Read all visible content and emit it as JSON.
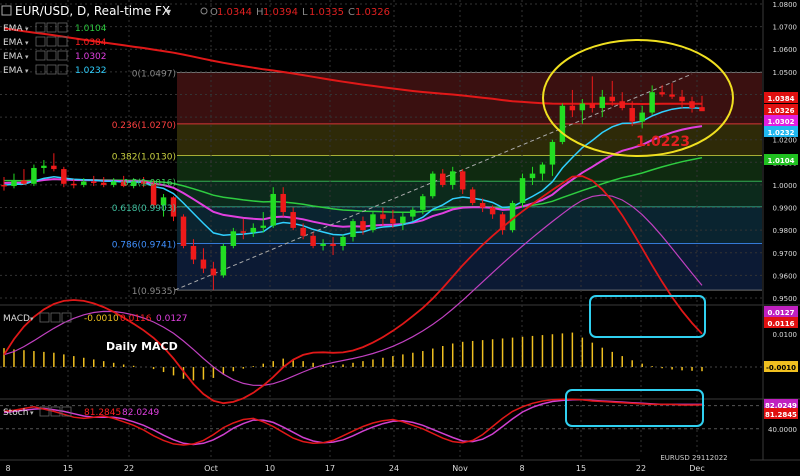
{
  "header": {
    "symbol_label": "EUR/USD, D, Real-time FX",
    "dropdown_arrow": "▾",
    "ohlc": [
      {
        "key": "O",
        "value": "1.0344"
      },
      {
        "key": "H",
        "value": "1.0394"
      },
      {
        "key": "L",
        "value": "1.0335"
      },
      {
        "key": "C",
        "value": "1.0326"
      }
    ]
  },
  "ema_legend": [
    {
      "label": "EMA",
      "value": "1.0104",
      "color": "#2ecc40"
    },
    {
      "label": "EMA",
      "value": "1.0384",
      "color": "#ff2020"
    },
    {
      "label": "EMA",
      "value": "1.0302",
      "color": "#e040e0"
    },
    {
      "label": "EMA",
      "value": "1.0232",
      "color": "#30d0ff"
    }
  ],
  "fib_levels": [
    {
      "text": "0(1.0497)",
      "value": 1.0497,
      "color": "#888888"
    },
    {
      "text": "0.236(1.0270)",
      "value": 1.027,
      "color": "#ff4040"
    },
    {
      "text": "0.382(1.0130)",
      "value": 1.013,
      "color": "#c8d040"
    },
    {
      "text": "0.5(1.0016)",
      "value": 1.0016,
      "color": "#40d060"
    },
    {
      "text": "0.618(0.9903)",
      "value": 0.9903,
      "color": "#40c0a0"
    },
    {
      "text": "0.786(0.9741)",
      "value": 0.9741,
      "color": "#4090ff"
    },
    {
      "text": "1(0.9535)",
      "value": 0.9535,
      "color": "#888888"
    }
  ],
  "annotation_value": "1.0223",
  "price_axis": [
    "1.0800",
    "1.0700",
    "1.0600",
    "1.0500",
    "1.0400",
    "1.0300",
    "1.0200",
    "1.0100",
    "1.0000",
    "0.9900",
    "0.9800",
    "0.9700",
    "0.9600",
    "0.9500"
  ],
  "price_tags": [
    {
      "text": "1.0384",
      "value": 1.0384,
      "color": "#e01010"
    },
    {
      "text": "1.0326",
      "value": 1.0326,
      "color": "#e01010"
    },
    {
      "text": "1.0302",
      "value": 1.0302,
      "color": "#e020e0"
    },
    {
      "text": "1.0232",
      "value": 1.0232,
      "color": "#20b8f0"
    },
    {
      "text": "1.0104",
      "value": 1.0104,
      "color": "#20c020"
    }
  ],
  "macd": {
    "label": "MACD",
    "values": [
      {
        "text": "-0.0010",
        "color": "#f0c020"
      },
      {
        "text": "0.0116",
        "color": "#ff2020"
      },
      {
        "text": "0.0127",
        "color": "#e040e0"
      }
    ],
    "title": "Daily MACD",
    "axis": [
      "0.0100",
      "0.0000"
    ],
    "tags": [
      {
        "text": "0.0127",
        "color": "#c020c0"
      },
      {
        "text": "0.0116",
        "color": "#e01010"
      },
      {
        "text": "-0.0010",
        "color": "#f0c020"
      }
    ]
  },
  "stoch": {
    "label": "Stoch",
    "values": [
      {
        "text": "81.2845",
        "color": "#ff2020"
      },
      {
        "text": "82.0249",
        "color": "#e040e0"
      }
    ],
    "axis": [
      "80.0000",
      "40.0000"
    ],
    "tags": [
      {
        "text": "82.0249",
        "color": "#c020c0"
      },
      {
        "text": "81.2845",
        "color": "#e01010"
      }
    ]
  },
  "x_axis": [
    "8",
    "15",
    "22",
    "Oct",
    "10",
    "17",
    "24",
    "Nov",
    "8",
    "15",
    "22",
    "Dec"
  ],
  "watermark": "EURUSD 29112022",
  "chart_data": {
    "type": "candlestick",
    "x_unit": "trading day",
    "y_range": [
      0.95,
      1.08
    ],
    "candles": [
      [
        1.0,
        1.0035,
        0.9975,
        0.9995
      ],
      [
        0.9995,
        1.005,
        0.9985,
        1.002
      ],
      [
        1.002,
        1.007,
        1.0,
        1.0005
      ],
      [
        1.0005,
        1.009,
        0.9995,
        1.0075
      ],
      [
        1.0075,
        1.011,
        1.005,
        1.0085
      ],
      [
        1.0085,
        1.014,
        1.006,
        1.007
      ],
      [
        1.007,
        1.008,
        0.999,
        1.0005
      ],
      [
        1.0005,
        1.0025,
        0.9985,
        1.0
      ],
      [
        1.0,
        1.003,
        0.999,
        1.0015
      ],
      [
        1.0015,
        1.004,
        0.9995,
        1.001
      ],
      [
        1.001,
        1.0035,
        0.999,
        1.0
      ],
      [
        1.0,
        1.003,
        0.999,
        1.0015
      ],
      [
        1.0015,
        1.004,
        0.999,
        0.9995
      ],
      [
        0.9995,
        1.003,
        0.9985,
        1.0015
      ],
      [
        1.0015,
        1.0035,
        0.999,
        1.0005
      ],
      [
        1.0005,
        1.002,
        0.99,
        0.991
      ],
      [
        0.991,
        0.996,
        0.986,
        0.9945
      ],
      [
        0.9945,
        0.995,
        0.984,
        0.986
      ],
      [
        0.986,
        0.987,
        0.972,
        0.973
      ],
      [
        0.973,
        0.976,
        0.965,
        0.967
      ],
      [
        0.967,
        0.972,
        0.961,
        0.963
      ],
      [
        0.963,
        0.966,
        0.9535,
        0.96
      ],
      [
        0.96,
        0.974,
        0.959,
        0.973
      ],
      [
        0.973,
        0.981,
        0.972,
        0.9795
      ],
      [
        0.9795,
        0.985,
        0.976,
        0.979
      ],
      [
        0.979,
        0.983,
        0.977,
        0.981
      ],
      [
        0.981,
        0.988,
        0.979,
        0.982
      ],
      [
        0.982,
        0.999,
        0.981,
        0.996
      ],
      [
        0.996,
        0.999,
        0.986,
        0.988
      ],
      [
        0.988,
        0.99,
        0.98,
        0.981
      ],
      [
        0.981,
        0.983,
        0.976,
        0.9775
      ],
      [
        0.9775,
        0.979,
        0.972,
        0.973
      ],
      [
        0.973,
        0.976,
        0.971,
        0.974
      ],
      [
        0.974,
        0.977,
        0.969,
        0.973
      ],
      [
        0.973,
        0.978,
        0.971,
        0.977
      ],
      [
        0.977,
        0.985,
        0.975,
        0.984
      ],
      [
        0.984,
        0.986,
        0.978,
        0.98
      ],
      [
        0.98,
        0.988,
        0.979,
        0.987
      ],
      [
        0.987,
        0.99,
        0.982,
        0.985
      ],
      [
        0.985,
        0.989,
        0.981,
        0.983
      ],
      [
        0.983,
        0.988,
        0.98,
        0.986
      ],
      [
        0.986,
        0.99,
        0.984,
        0.989
      ],
      [
        0.989,
        0.996,
        0.987,
        0.995
      ],
      [
        0.995,
        1.006,
        0.994,
        1.005
      ],
      [
        1.005,
        1.007,
        0.999,
        1.0
      ],
      [
        1.0,
        1.008,
        0.998,
        1.006
      ],
      [
        1.006,
        1.007,
        0.996,
        0.998
      ],
      [
        0.998,
        0.999,
        0.991,
        0.992
      ],
      [
        0.992,
        0.994,
        0.988,
        0.99
      ],
      [
        0.99,
        0.991,
        0.985,
        0.987
      ],
      [
        0.987,
        0.988,
        0.978,
        0.98
      ],
      [
        0.98,
        0.993,
        0.979,
        0.992
      ],
      [
        0.992,
        1.005,
        0.99,
        1.003
      ],
      [
        1.003,
        1.008,
        1.0,
        1.005
      ],
      [
        1.005,
        1.01,
        1.002,
        1.009
      ],
      [
        1.009,
        1.02,
        1.004,
        1.019
      ],
      [
        1.019,
        1.036,
        1.018,
        1.035
      ],
      [
        1.035,
        1.042,
        1.03,
        1.033
      ],
      [
        1.033,
        1.038,
        1.027,
        1.036
      ],
      [
        1.036,
        1.048,
        1.032,
        1.034
      ],
      [
        1.034,
        1.042,
        1.03,
        1.039
      ],
      [
        1.039,
        1.046,
        1.035,
        1.037
      ],
      [
        1.037,
        1.041,
        1.033,
        1.034
      ],
      [
        1.034,
        1.037,
        1.026,
        1.028
      ],
      [
        1.028,
        1.035,
        1.025,
        1.032
      ],
      [
        1.032,
        1.044,
        1.031,
        1.041
      ],
      [
        1.041,
        1.044,
        1.039,
        1.04
      ],
      [
        1.04,
        1.045,
        1.038,
        1.039
      ],
      [
        1.039,
        1.042,
        1.034,
        1.037
      ],
      [
        1.037,
        1.039,
        1.032,
        1.034
      ],
      [
        1.0344,
        1.0394,
        1.0335,
        1.0326
      ]
    ],
    "macd_histogram": [
      0.0045,
      0.0042,
      0.004,
      0.0038,
      0.0036,
      0.0034,
      0.003,
      0.0026,
      0.0022,
      0.0018,
      0.0014,
      0.001,
      0.0006,
      0.0003,
      0.0,
      -0.0005,
      -0.0012,
      -0.002,
      -0.0028,
      -0.0032,
      -0.003,
      -0.0026,
      -0.0018,
      -0.001,
      -0.0004,
      0.0002,
      0.0008,
      0.0014,
      0.002,
      0.0018,
      0.0014,
      0.001,
      0.0006,
      0.0004,
      0.0006,
      0.001,
      0.0014,
      0.0018,
      0.0022,
      0.0026,
      0.003,
      0.0034,
      0.0038,
      0.0044,
      0.005,
      0.0056,
      0.006,
      0.0062,
      0.0064,
      0.0066,
      0.0068,
      0.007,
      0.0072,
      0.0074,
      0.0076,
      0.0078,
      0.008,
      0.0082,
      0.007,
      0.0058,
      0.0046,
      0.0036,
      0.0026,
      0.0016,
      0.0008,
      0.0002,
      -0.0003,
      -0.0006,
      -0.0008,
      -0.0009,
      -0.001
    ],
    "stoch_k": [
      70,
      72,
      75,
      78,
      74,
      70,
      65,
      60,
      58,
      60,
      62,
      58,
      52,
      46,
      38,
      28,
      20,
      14,
      12,
      14,
      20,
      30,
      42,
      50,
      56,
      58,
      52,
      44,
      34,
      24,
      18,
      15,
      16,
      20,
      28,
      36,
      44,
      50,
      54,
      56,
      52,
      46,
      40,
      32,
      24,
      18,
      16,
      20,
      30,
      44,
      58,
      70,
      78,
      84,
      88,
      90,
      91,
      91,
      90,
      88,
      87,
      86,
      85,
      84,
      83,
      82,
      82,
      82,
      81,
      81,
      81.28
    ],
    "stoch_d": [
      68,
      70,
      72,
      74,
      75,
      73,
      70,
      66,
      62,
      60,
      60,
      60,
      57,
      52,
      46,
      38,
      29,
      21,
      15,
      13,
      15,
      21,
      30,
      41,
      49,
      55,
      55,
      51,
      43,
      34,
      25,
      19,
      16,
      17,
      21,
      28,
      36,
      43,
      49,
      53,
      54,
      51,
      46,
      39,
      32,
      25,
      19,
      18,
      22,
      31,
      44,
      57,
      69,
      77,
      83,
      87,
      89,
      90,
      90,
      89,
      88,
      87,
      86,
      85,
      84,
      83,
      82,
      82,
      82,
      82,
      82.02
    ]
  }
}
